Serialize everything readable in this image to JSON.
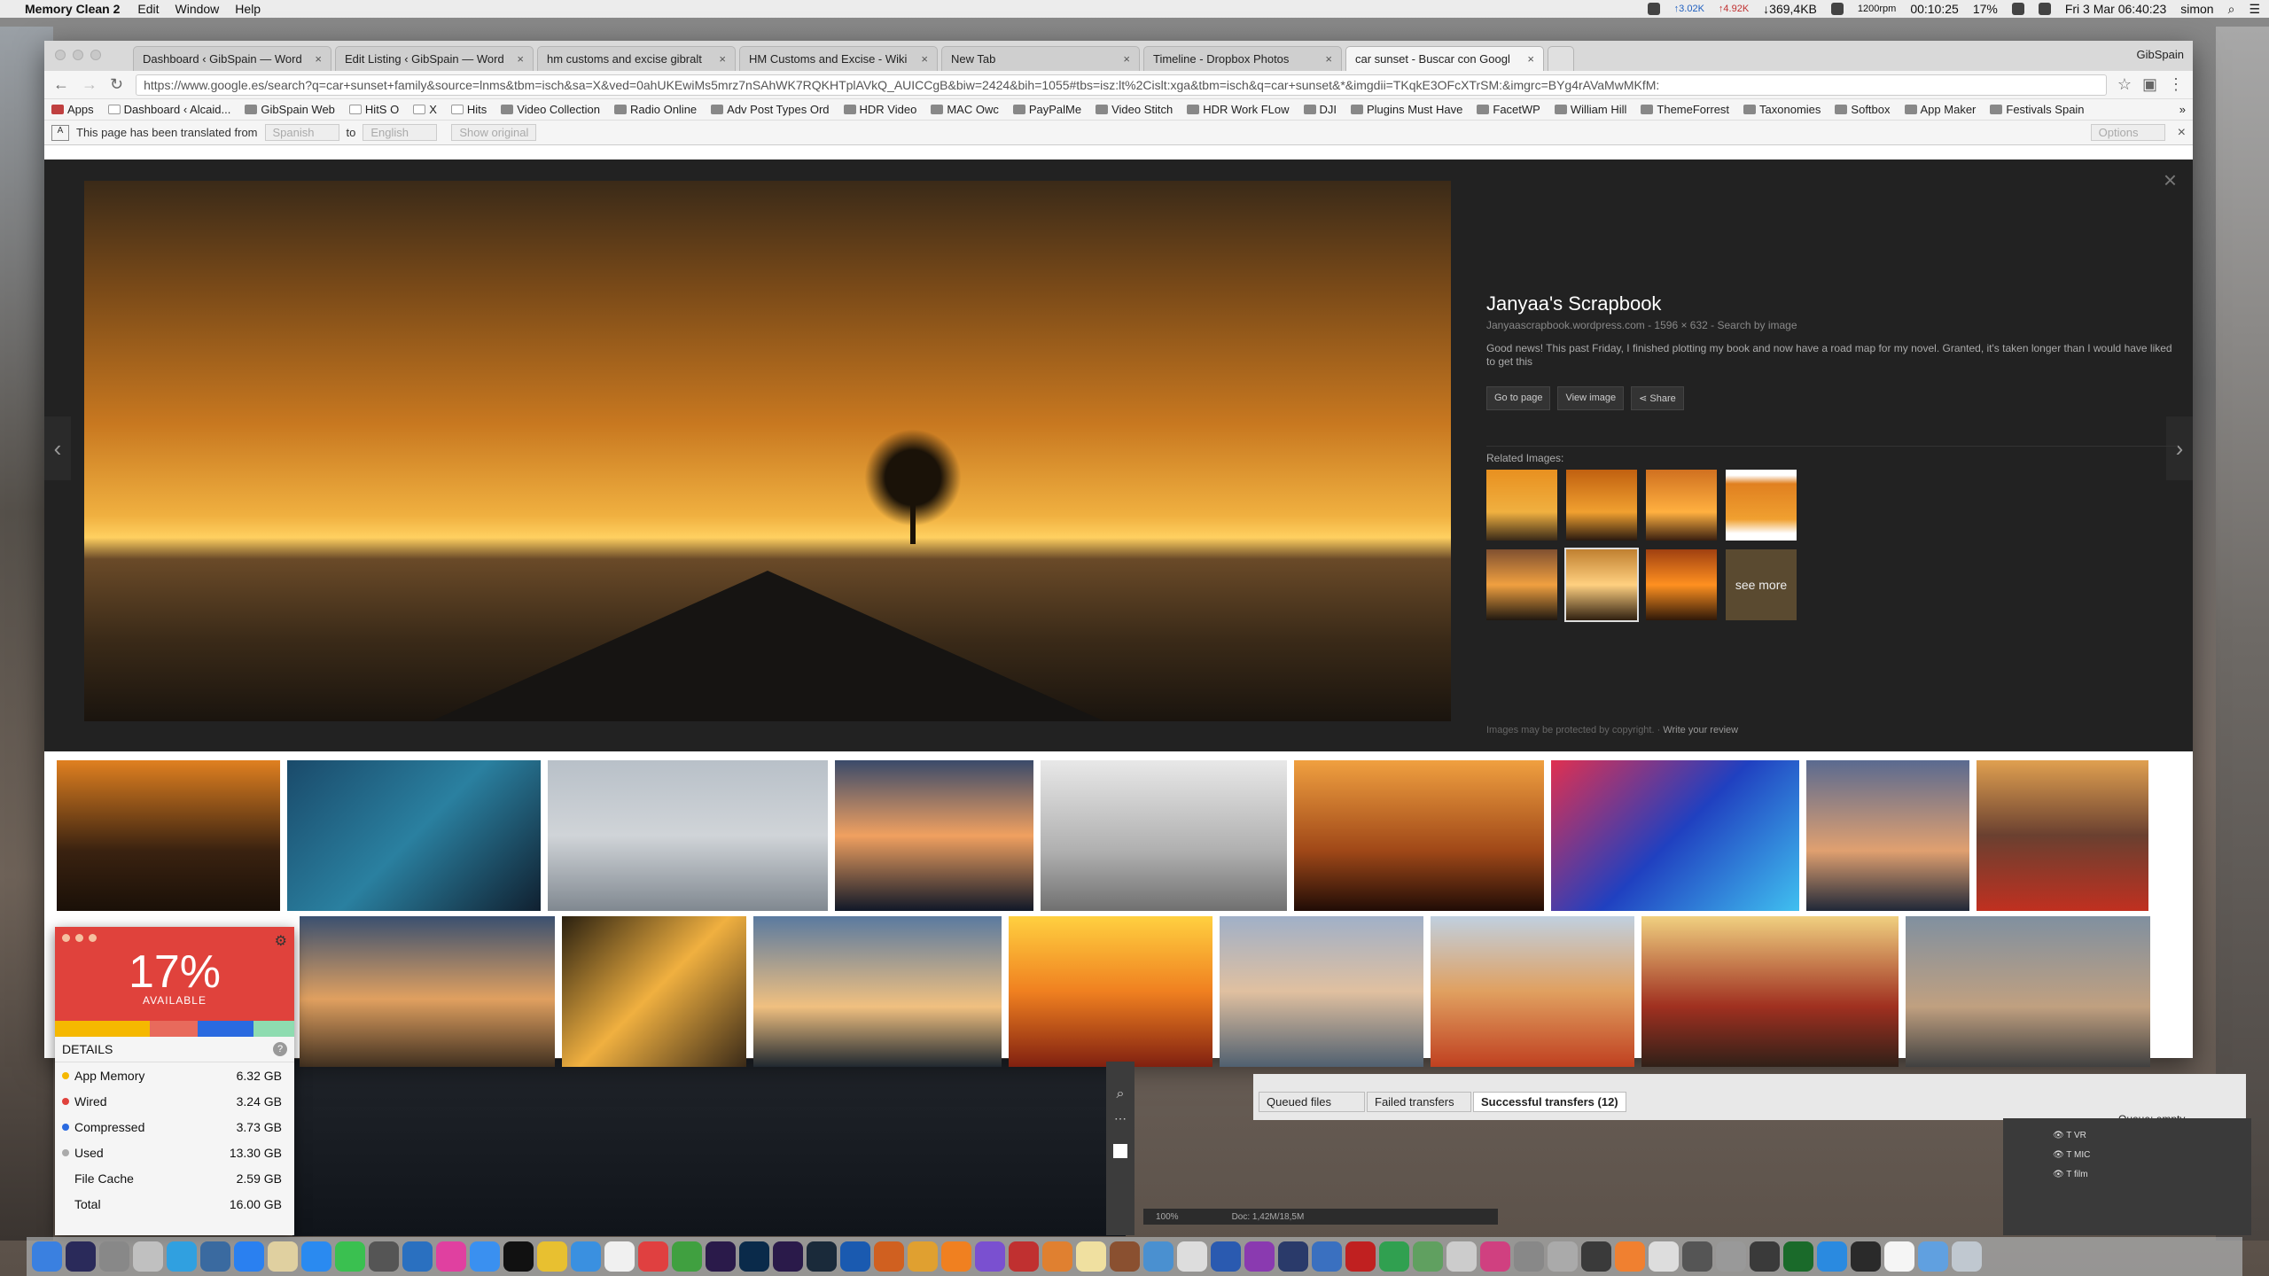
{
  "menubar": {
    "app_name": "Memory Clean 2",
    "menus": [
      "Edit",
      "Window",
      "Help"
    ],
    "net_up": "↑3.02K",
    "net_down": "↑4.92K",
    "mem_reading": "↓369,4KB",
    "resolution": "1200rpm",
    "timer": "00:10:25",
    "battery": "17%",
    "datetime": "Fri 3 Mar  06:40:23",
    "user": "simon"
  },
  "browser": {
    "profile": "GibSpain",
    "tabs": [
      {
        "title": "Dashboard ‹ GibSpain — Word"
      },
      {
        "title": "Edit Listing ‹ GibSpain — Word"
      },
      {
        "title": "hm customs and excise gibralt"
      },
      {
        "title": "HM Customs and Excise - Wiki"
      },
      {
        "title": "New Tab"
      },
      {
        "title": "Timeline - Dropbox Photos"
      },
      {
        "title": "car sunset - Buscar con Googl"
      }
    ],
    "url": "https://www.google.es/search?q=car+sunset+family&source=lnms&tbm=isch&sa=X&ved=0ahUKEwiMs5mrz7nSAhWK7RQKHTplAVkQ_AUICCgB&biw=2424&bih=1055#tbs=isz:lt%2Cislt:xga&tbm=isch&q=car+sunset&*&imgdii=TKqkE3OFcXTrSM:&imgrc=BYg4rAVaMwMKfM:",
    "bookmarks": [
      "Apps",
      "Dashboard ‹ Alcaid...",
      "GibSpain Web",
      "HitS O",
      "X",
      "Hits",
      "Video Collection",
      "Radio Online",
      "Adv Post Types Ord",
      "HDR Video",
      "MAC Owc",
      "PayPalMe",
      "Video Stitch",
      "HDR Work FLow",
      "DJI",
      "Plugins Must Have",
      "FacetWP",
      "William Hill",
      "ThemeForrest",
      "Taxonomies",
      "Softbox",
      "App Maker",
      "Festivals Spain"
    ],
    "translate": {
      "message": "This page has been translated from",
      "from": "Spanish",
      "to_label": "to",
      "to": "English",
      "show_original": "Show original",
      "options": "Options"
    }
  },
  "viewer": {
    "source_title": "Janyaa's Scrapbook",
    "meta": "Janyaascrapbook.wordpress.com - 1596 × 632 - Search by image",
    "description": "Good news! This past Friday, I finished plotting my book and now have a road map for my novel. Granted, it's taken longer than I would have liked to get this",
    "buttons": {
      "goto": "Go to page",
      "view": "View image",
      "share": "Share"
    },
    "related_label": "Related Images:",
    "see_more": "see more",
    "copyright": "Images may be protected by copyright.",
    "review": "Write your review"
  },
  "memory": {
    "percent": "17%",
    "available": "AVAILABLE",
    "details": "DETAILS",
    "rows": [
      {
        "label": "App Memory",
        "value": "6.32 GB",
        "color": "#f5b800"
      },
      {
        "label": "Wired",
        "value": "3.24 GB",
        "color": "#e0423c"
      },
      {
        "label": "Compressed",
        "value": "3.73 GB",
        "color": "#2a6ae0"
      },
      {
        "label": "Used",
        "value": "13.30 GB",
        "color": "#aaaaaa"
      },
      {
        "label": "File Cache",
        "value": "2.59 GB",
        "color": ""
      },
      {
        "label": "Total",
        "value": "16.00 GB",
        "color": ""
      }
    ]
  },
  "ftp": {
    "tabs": [
      "Queued files",
      "Failed transfers",
      "Successful transfers (12)"
    ],
    "queue": "Queue: empty"
  },
  "photoshop": {
    "zoom": "100%",
    "doc": "Doc: 1,42M/18,5M",
    "layers": [
      "VR",
      "MIC",
      "film"
    ]
  }
}
